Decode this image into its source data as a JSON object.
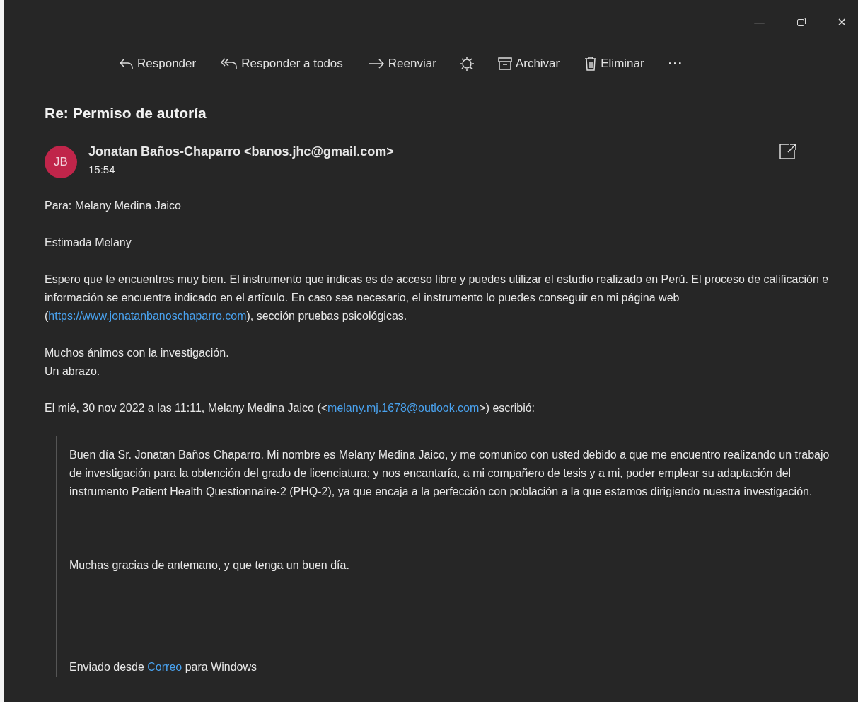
{
  "window_controls": {
    "minimize": "—",
    "close": "✕"
  },
  "toolbar": [
    {
      "kind": "reply",
      "label": "Responder"
    },
    {
      "kind": "reply_all",
      "label": "Responder a todos"
    },
    {
      "kind": "forward",
      "label": "Reenviar"
    },
    {
      "kind": "theme"
    },
    {
      "kind": "archive",
      "label": "Archivar"
    },
    {
      "kind": "delete",
      "label": "Eliminar"
    },
    {
      "kind": "more",
      "label": "···"
    }
  ],
  "subject": "Re: Permiso de autoría",
  "sender": {
    "initials": "JB",
    "color": "#c0254a",
    "name": "Jonatan Baños-Chaparro <banos.jhc@gmail.com>",
    "time": "15:54"
  },
  "to": "Para: Melany Medina Jaico",
  "greeting": "Estimada Melany",
  "paragraph": {
    "before": "Espero que te encuentres muy bien. El instrumento que indicas es de acceso libre y puedes utilizar el estudio realizado en Perú. El proceso de calificación e información se encuentra indicado en el artículo. En caso sea necesario, el instrumento lo puedes conseguir en mi página web (",
    "link": "https://www.jonatanbanoschaparro.com",
    "after": "), sección pruebas psicológicas."
  },
  "closing": [
    "Muchos ánimos con la investigación.",
    "Un abrazo."
  ],
  "quote_header": {
    "before": "El mié, 30 nov 2022 a las 11:11, Melany Medina Jaico (<",
    "link": "melany.mj.1678@outlook.com",
    "after": ">) escribió:"
  },
  "quote": {
    "body": "Buen día Sr. Jonatan Baños Chaparro. Mi nombre es Melany Medina Jaico, y me  comunico con usted debido a que me encuentro realizando un  trabajo de investigación para la obtención del grado de licenciatura; y nos encantaría, a mi compañero de tesis y a mi, poder emplear su adaptación del instrumento Patient Health Questionnaire-2 (PHQ-2), ya que encaja a la perfección con población a la que estamos dirigiendo nuestra investigación.",
    "thanks": "Muchas gracias de antemano, y que tenga un buen día.",
    "signature": {
      "before": "Enviado desde ",
      "link": "Correo",
      "after": " para Windows"
    }
  }
}
